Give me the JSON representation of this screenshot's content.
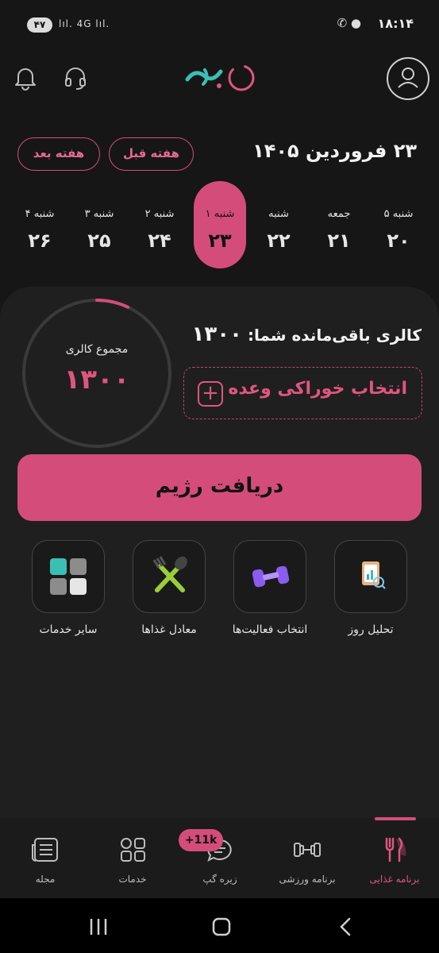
{
  "status_bar": {
    "battery": "۴۷",
    "network": "4G",
    "time": "۱۸:۱۴"
  },
  "header": {
    "logo_text": "زیره",
    "icons": [
      "bell-icon",
      "headset-icon",
      "user-avatar-icon"
    ]
  },
  "date_nav": {
    "title": "۲۳ فروردین ۱۴۰۵",
    "prev_week_label": "هفته قبل",
    "next_week_label": "هفته بعد"
  },
  "week": [
    {
      "name": "۵ شنبه",
      "day": "۲۰",
      "active": false
    },
    {
      "name": "جمعه",
      "day": "۲۱",
      "active": false
    },
    {
      "name": "شنبه",
      "day": "۲۲",
      "active": false
    },
    {
      "name": "۱ شنبه",
      "day": "۲۳",
      "active": true
    },
    {
      "name": "۲ شنبه",
      "day": "۲۴",
      "active": false
    },
    {
      "name": "۳ شنبه",
      "day": "۲۵",
      "active": false
    },
    {
      "name": "۴ شنبه",
      "day": "۲۶",
      "active": false
    }
  ],
  "calorie": {
    "ring_label": "مجموع کالری",
    "ring_value": "۱۳۰۰",
    "remaining_label": "کالری باقی‌مانده شما:",
    "remaining_value": "۱۳۰۰",
    "progress": 0.07
  },
  "select_meal_label": "انتخاب خوراکی وعده",
  "diet_button_label": "دریافت رژیم",
  "services": [
    {
      "label": "تحلیل روز",
      "icon": "day-analysis-icon"
    },
    {
      "label": "انتخاب فعالیت‌ها",
      "icon": "dumbbell-icon"
    },
    {
      "label": "معادل غذاها",
      "icon": "fork-spoon-icon"
    },
    {
      "label": "سایر خدمات",
      "icon": "grid-apps-icon"
    }
  ],
  "bottom_nav": {
    "items": [
      {
        "label": "برنامه غذایی",
        "icon": "fork-knife-icon",
        "active": true
      },
      {
        "label": "برنامه ورزشی",
        "icon": "dumbbell-icon",
        "active": false
      },
      {
        "label": "زیره گپ",
        "icon": "chat-icon",
        "active": false
      },
      {
        "label": "خدمات",
        "icon": "services-grid-icon",
        "active": false
      },
      {
        "label": "مجله",
        "icon": "magazine-icon",
        "active": false
      }
    ],
    "chat_badge": "+11k"
  },
  "colors": {
    "accent": "#d44d7a",
    "background": "#161616",
    "card": "#1f1f1f"
  }
}
